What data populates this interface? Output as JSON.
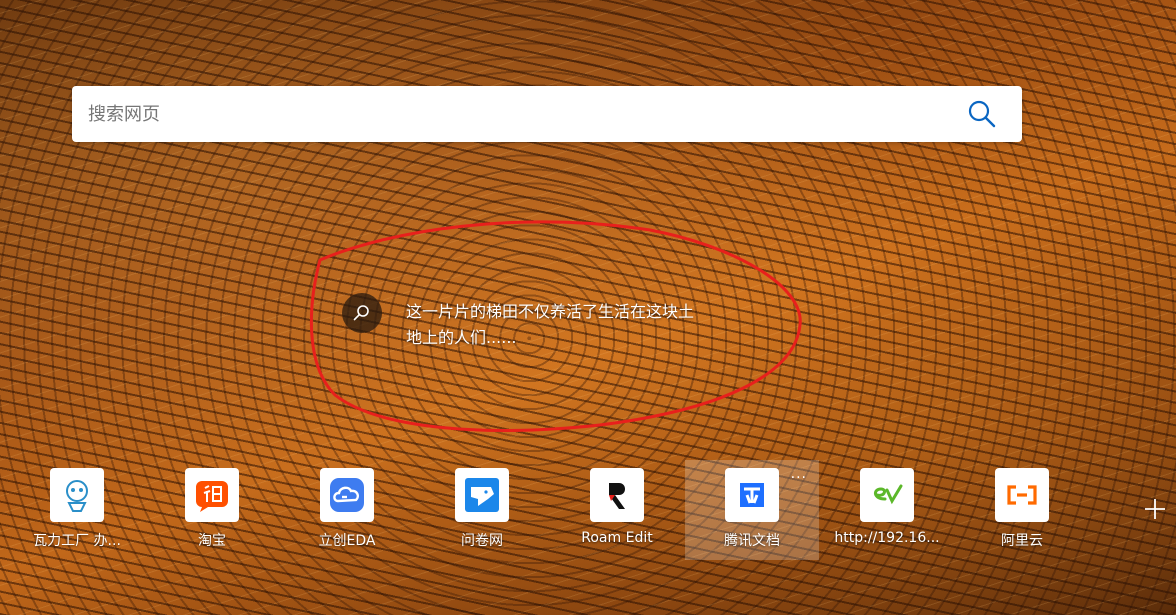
{
  "search": {
    "placeholder": "搜索网页",
    "value": ""
  },
  "image_caption": {
    "line1": "这一片片的梯田不仅养活了生活在这块土",
    "line2": "地上的人们......"
  },
  "tiles": [
    {
      "label": "瓦力工厂 办...",
      "icon": "wali-robot-icon",
      "color": "#2a8fc9"
    },
    {
      "label": "淘宝",
      "icon": "taobao-icon",
      "color": "#ff5000"
    },
    {
      "label": "立创EDA",
      "icon": "lceda-cloud-icon",
      "color": "#2f6fe6"
    },
    {
      "label": "问卷网",
      "icon": "wenjuan-icon",
      "color": "#1b87ea"
    },
    {
      "label": "Roam Edit",
      "icon": "roam-edit-icon",
      "color": "#111111"
    },
    {
      "label": "腾讯文档",
      "icon": "tencent-docs-icon",
      "color": "#1e6fff"
    },
    {
      "label": "http://192.16...",
      "icon": "ev-icon",
      "color": "#5cb82a"
    },
    {
      "label": "阿里云",
      "icon": "aliyun-icon",
      "color": "#ff6a00"
    }
  ],
  "tile_more_label": "···",
  "annotation_color": "#e8201c"
}
